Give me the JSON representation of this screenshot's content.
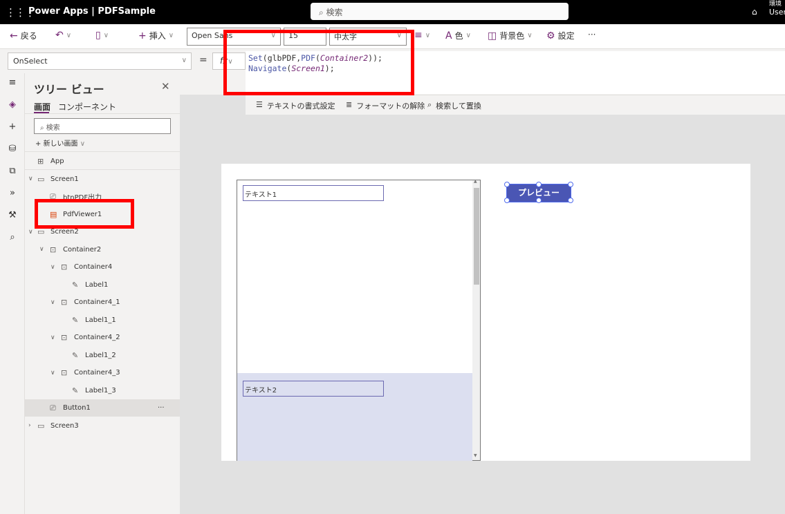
{
  "topbar": {
    "app_title": "Power Apps  |  PDFSample",
    "search_placeholder": "検索",
    "env_label": "環境",
    "user": "User"
  },
  "toolbar": {
    "back": "戻る",
    "insert": "挿入",
    "font": "Open Sans",
    "font_size": "15",
    "font_weight": "中太字",
    "color": "色",
    "bg_color": "背景色",
    "settings": "設定",
    "more": "···"
  },
  "formula": {
    "property": "OnSelect",
    "equals": "=",
    "fx": "fx",
    "line1": {
      "fn1": "Set",
      "a1": "(glbPDF,",
      "fn2": "PDF",
      "a2": "(",
      "ctrl": "Container2",
      "a3": "));"
    },
    "line2": {
      "fn": "Navigate",
      "a1": "(",
      "ctrl": "Screen1",
      "a2": ");"
    }
  },
  "format_bar": {
    "format_text": "テキストの書式設定",
    "remove_format": "フォーマットの解除",
    "find_replace": "検索して置換"
  },
  "tree": {
    "title": "ツリー ビュー",
    "tabs": [
      "画面",
      "コンポーネント"
    ],
    "search_placeholder": "検索",
    "new_screen": "新しい画面",
    "items": [
      {
        "label": "App",
        "icon": "app-icon",
        "level": 0
      },
      {
        "label": "Screen1",
        "icon": "screen-icon",
        "level": 0,
        "expanded": true
      },
      {
        "label": "btnPDF出力",
        "icon": "button-icon",
        "level": 1
      },
      {
        "label": "PdfViewer1",
        "icon": "pdf-icon",
        "level": 1
      },
      {
        "label": "Screen2",
        "icon": "screen-icon",
        "level": 0,
        "expanded": true
      },
      {
        "label": "Container2",
        "icon": "container-icon",
        "level": 1,
        "expanded": true
      },
      {
        "label": "Container4",
        "icon": "container-icon",
        "level": 2,
        "expanded": true
      },
      {
        "label": "Label1",
        "icon": "label-icon",
        "level": 3
      },
      {
        "label": "Container4_1",
        "icon": "container-icon",
        "level": 2,
        "expanded": true
      },
      {
        "label": "Label1_1",
        "icon": "label-icon",
        "level": 3
      },
      {
        "label": "Container4_2",
        "icon": "container-icon",
        "level": 2,
        "expanded": true
      },
      {
        "label": "Label1_2",
        "icon": "label-icon",
        "level": 3
      },
      {
        "label": "Container4_3",
        "icon": "container-icon",
        "level": 2,
        "expanded": true
      },
      {
        "label": "Label1_3",
        "icon": "label-icon",
        "level": 3
      },
      {
        "label": "Button1",
        "icon": "button-icon",
        "level": 1,
        "selected": true
      },
      {
        "label": "Screen3",
        "icon": "screen-icon",
        "level": 0,
        "expanded": false
      }
    ],
    "more": "···"
  },
  "canvas": {
    "text1": "テキスト1",
    "text2": "テキスト2",
    "preview_button": "プレビュー"
  },
  "colors": {
    "accent": "#742774",
    "button": "#4a56b4",
    "highlight": "#ff0000"
  }
}
